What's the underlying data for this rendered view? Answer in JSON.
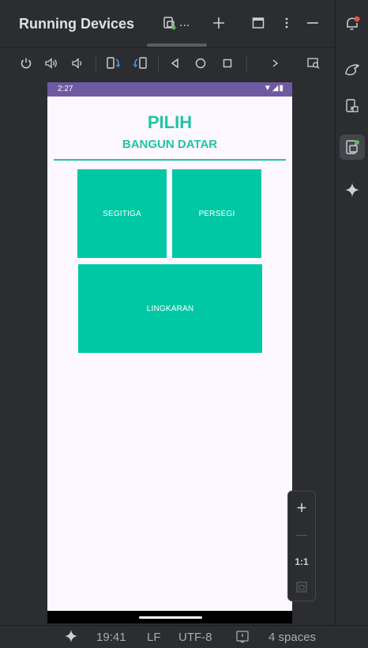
{
  "panel": {
    "title": "Running Devices",
    "device_tab_label": "...",
    "icons": [
      "device-tab-icon",
      "add-icon",
      "window-icon",
      "more-vertical-icon",
      "minimize-icon"
    ]
  },
  "toolbar": {
    "icons": [
      "power-icon",
      "volume-up-icon",
      "volume-down-icon",
      "rotate-left-icon",
      "rotate-right-icon",
      "back-icon",
      "home-icon",
      "overview-icon",
      "chevron-right-icon",
      "screenshot-icon"
    ]
  },
  "right_strip": {
    "icons": [
      "notifications-icon",
      "gemini-gecko-icon",
      "device-manager-icon",
      "running-devices-icon",
      "ai-sparkle-icon"
    ]
  },
  "phone": {
    "status_time": "2:27",
    "status_icons": "▼◢▮",
    "title": "PILIH",
    "subtitle": "BANGUN DATAR",
    "buttons": {
      "segitiga": "SEGITIGA",
      "persegi": "PERSEGI",
      "lingkaran": "LINGKARAN"
    }
  },
  "zoom": {
    "zoom_in": "+",
    "zoom_out": "—",
    "actual_size": "1:1"
  },
  "footer": {
    "time": "19:41",
    "line_ending": "LF",
    "encoding": "UTF-8",
    "indent": "4 spaces"
  },
  "colors": {
    "accent": "#21C4A3",
    "button_bg": "#00C8A5",
    "status_bar": "#6F59A3",
    "phone_bg": "#FDF7FF",
    "ide_bg": "#2B2D30",
    "notif_red": "#E5534B",
    "notif_green": "#5FB865"
  }
}
